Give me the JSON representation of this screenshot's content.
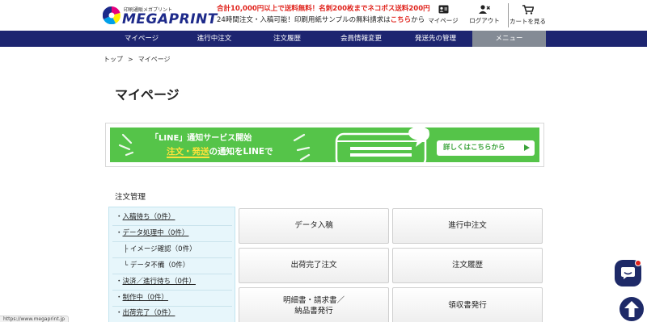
{
  "header": {
    "logo_sub": "印刷通販メガプリント",
    "logo_name": "MEGAPRINT",
    "promo_line1": "合計10,000円以上で送料無料！名刺200枚までネコポス送料200円",
    "promo_line2_pre": "24時間注文・入稿可能！印刷用紙サンプルの無料請求は",
    "promo_line2_link": "こちら",
    "promo_line2_post": "から",
    "mypage_label": "マイページ",
    "logout_label": "ログアウト",
    "cart_label": "カートを見る"
  },
  "nav": [
    "マイページ",
    "進行中注文",
    "注文履歴",
    "会員情報変更",
    "発送先の管理",
    "メニュー"
  ],
  "breadcrumb": {
    "top": "トップ",
    "sep": ">",
    "current": "マイページ"
  },
  "page_title": "マイページ",
  "line_banner": {
    "line1": "「LINE」通知サービス開始",
    "line2_pre": "注文・発送",
    "line2_post": "の通知をLINEで",
    "cta": "詳しくはこちらから"
  },
  "section_title": "注文管理",
  "status_items": [
    {
      "prefix": "・",
      "label": "入稿待ち（0件）"
    },
    {
      "prefix": "・",
      "label": "データ処理中（0件）"
    },
    {
      "prefix": "├ ",
      "label": "イメージ確認（0件）"
    },
    {
      "prefix": "└ ",
      "label": "データ不備（0件）"
    },
    {
      "prefix": "・",
      "label": "決済／進行待ち（0件）"
    },
    {
      "prefix": "・",
      "label": "制作中（0件）"
    },
    {
      "prefix": "・",
      "label": "出荷完了（0件）"
    }
  ],
  "tiles": [
    "データ入稿",
    "進行中注文",
    "出荷完了注文",
    "注文履歴",
    "明細書・請求書／\n納品書発行",
    "領収書発行"
  ],
  "status_url": "https://www.megaprint.jp",
  "colors": {
    "nav_bg": "#1d2570",
    "nav_active": "#848b95",
    "line_green": "#55c449",
    "accent_red": "#e0221b"
  }
}
